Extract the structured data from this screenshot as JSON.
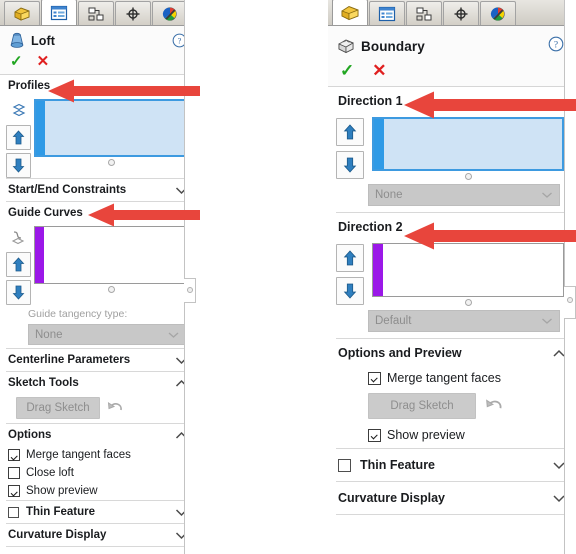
{
  "app": {
    "name": "SolidWorks PropertyManager",
    "accent_blue": "#2f9ae6",
    "accent_purple": "#9b18e8",
    "annotation_color": "#e8453c"
  },
  "left_panel": {
    "tabs": [
      {
        "id": "feature-manager-tree",
        "icon": "yellow-feature-icon",
        "selected": false
      },
      {
        "id": "property-manager",
        "icon": "property-list-icon",
        "selected": true
      },
      {
        "id": "configuration-manager",
        "icon": "configuration-icon",
        "selected": false
      },
      {
        "id": "dimxpert-manager",
        "icon": "dimxpert-target-icon",
        "selected": false
      },
      {
        "id": "display-manager",
        "icon": "display-appearance-icon",
        "selected": false
      }
    ],
    "header": {
      "title": "Loft",
      "icon": "loft-feature-icon",
      "help": "?",
      "ok": "✓",
      "cancel": "✕"
    },
    "sections": [
      {
        "id": "profiles",
        "label": "Profiles",
        "collapsible": false
      },
      {
        "id": "start-end-constraints",
        "label": "Start/End Constraints",
        "chevron": "down"
      },
      {
        "id": "guide-curves",
        "label": "Guide Curves",
        "collapsible": false
      },
      {
        "id": "centerline-parameters",
        "label": "Centerline Parameters",
        "chevron": "down"
      },
      {
        "id": "sketch-tools",
        "label": "Sketch Tools",
        "chevron": "up"
      },
      {
        "id": "options",
        "label": "Options",
        "chevron": "up"
      },
      {
        "id": "thin-feature",
        "label": "Thin Feature",
        "chevron": "down",
        "checkbox": false
      },
      {
        "id": "curvature-display",
        "label": "Curvature Display",
        "chevron": "down"
      }
    ],
    "profiles": {
      "mini_icon": "profiles-sketch-icon",
      "move_up": "⇧",
      "move_down": "⇩",
      "selection_value": ""
    },
    "guide_curves": {
      "mini_icon": "guide-curve-icon",
      "move_up": "⇧",
      "move_down": "⇩",
      "selection_value": "",
      "tangency_label": "Guide tangency type:",
      "tangency_value": "None"
    },
    "sketch_tools": {
      "drag_sketch_label": "Drag Sketch",
      "undo_icon": "undo-arrow-icon"
    },
    "options": {
      "items": [
        {
          "label": "Merge tangent faces",
          "checked": true
        },
        {
          "label": "Close loft",
          "checked": false
        },
        {
          "label": "Show preview",
          "checked": true
        }
      ]
    }
  },
  "right_panel": {
    "tabs": [
      {
        "id": "feature-manager-tree",
        "icon": "yellow-feature-icon",
        "selected": true
      },
      {
        "id": "property-manager",
        "icon": "property-list-icon",
        "selected": false
      },
      {
        "id": "configuration-manager",
        "icon": "configuration-icon",
        "selected": false
      },
      {
        "id": "dimxpert-manager",
        "icon": "dimxpert-target-icon",
        "selected": false
      },
      {
        "id": "display-manager",
        "icon": "display-appearance-icon",
        "selected": false
      }
    ],
    "header": {
      "title": "Boundary",
      "icon": "boundary-feature-icon",
      "help": "?",
      "ok": "✓",
      "cancel": "✕"
    },
    "sections": [
      {
        "id": "direction-1",
        "label": "Direction 1",
        "collapsible": false
      },
      {
        "id": "direction-2",
        "label": "Direction 2",
        "collapsible": false
      },
      {
        "id": "options-and-preview",
        "label": "Options and Preview",
        "chevron": "up"
      },
      {
        "id": "thin-feature",
        "label": "Thin Feature",
        "chevron": "down",
        "checkbox": false
      },
      {
        "id": "curvature-display",
        "label": "Curvature Display",
        "chevron": "down"
      }
    ],
    "direction_1": {
      "move_up": "⇧",
      "move_down": "⇩",
      "selection_value": "",
      "combo_value": "None"
    },
    "direction_2": {
      "move_up": "⇧",
      "move_down": "⇩",
      "selection_value": "",
      "combo_value": "Default"
    },
    "options_and_preview": {
      "merge_tangent_faces": {
        "label": "Merge tangent faces",
        "checked": true
      },
      "drag_sketch_label": "Drag Sketch",
      "undo_icon": "undo-arrow-icon",
      "show_preview": {
        "label": "Show preview",
        "checked": true
      }
    }
  },
  "annotations": [
    {
      "id": "arrow-profiles",
      "points_to": "Profiles",
      "direction": "left"
    },
    {
      "id": "arrow-guide-curves",
      "points_to": "Guide Curves",
      "direction": "left"
    },
    {
      "id": "arrow-direction-1",
      "points_to": "Direction 1",
      "direction": "left"
    },
    {
      "id": "arrow-direction-2",
      "points_to": "Direction 2",
      "direction": "left"
    }
  ]
}
